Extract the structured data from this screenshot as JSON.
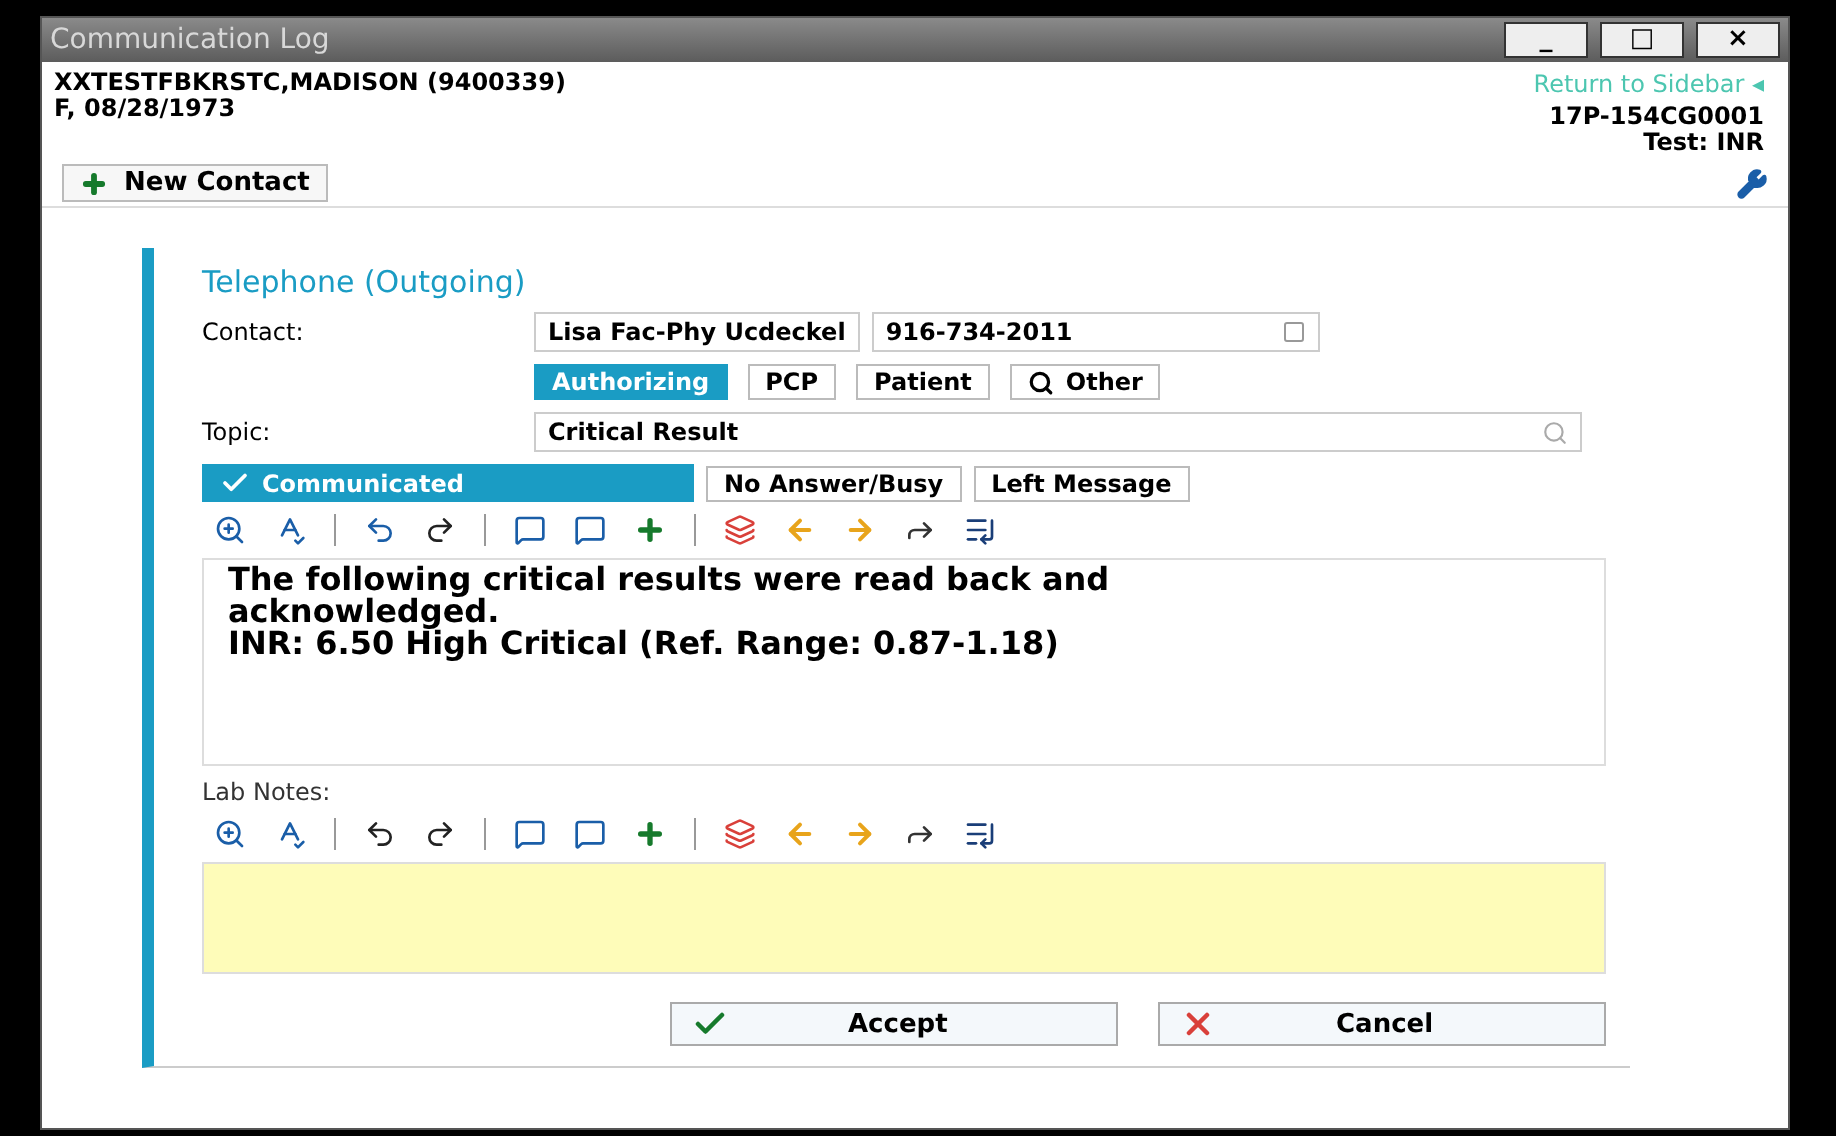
{
  "window": {
    "title": "Communication Log",
    "controls": [
      "_",
      "□",
      "×"
    ]
  },
  "header": {
    "patient": "XXTESTFBKRSTC,MADISON (9400339)",
    "demographics": "F, 08/28/1973",
    "return_link": "Return to Sidebar",
    "return_arrow": "◂",
    "accession": "17P-154CG0001",
    "test": "Test: INR"
  },
  "toolbar": {
    "new_contact": "New Contact"
  },
  "contact_form": {
    "heading": "Telephone (Outgoing)",
    "contact_label": "Contact:",
    "contact_name": "Lisa Fac-Phy Ucdeckel",
    "contact_phone": "916-734-2011",
    "contact_types": [
      {
        "label": "Authorizing",
        "selected": true,
        "kind": "plain"
      },
      {
        "label": "PCP",
        "selected": false,
        "kind": "plain"
      },
      {
        "label": "Patient",
        "selected": false,
        "kind": "plain"
      },
      {
        "label": "Other",
        "selected": false,
        "kind": "search"
      }
    ],
    "topic_label": "Topic:",
    "topic": "Critical Result",
    "outcomes": [
      {
        "label": "Communicated",
        "selected": true
      },
      {
        "label": "No Answer/Busy",
        "selected": false
      },
      {
        "label": "Left Message",
        "selected": false
      }
    ],
    "message": "The following critical results were read back and acknowledged.\nINR: 6.50 High Critical (Ref. Range: 0.87-1.18)",
    "lab_notes_label": "Lab Notes:",
    "buttons": [
      {
        "label": "Accept",
        "kind": "accept"
      },
      {
        "label": "Cancel",
        "kind": "cancel"
      }
    ]
  }
}
